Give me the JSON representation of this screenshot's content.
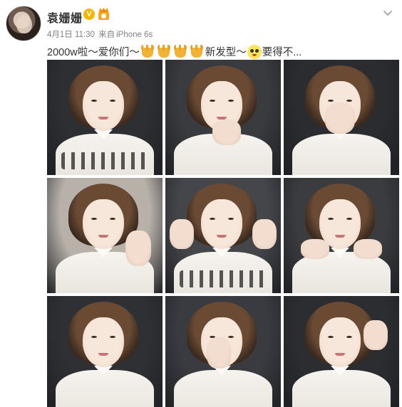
{
  "post": {
    "username": "袁姗姗",
    "verified_badge": "V",
    "timestamp": "4月1日 11:30",
    "source_prefix": "来自",
    "source": "iPhone 6s",
    "text_parts": [
      "2000w啦～爱你们～",
      "新发型～",
      "要得不..."
    ],
    "emoji_horns_count": 4,
    "icons": {
      "verified": "verified-v-icon",
      "member": "member-crown-icon",
      "menu": "chevron-down-icon"
    },
    "colors": {
      "badge": "#f7b500",
      "meta_text": "#808080",
      "text": "#333333"
    }
  },
  "photos": [
    {
      "label": "photo-1",
      "bg": "#2d2f33",
      "hair_offset": 0,
      "hand": "none",
      "pattern": true
    },
    {
      "label": "photo-2",
      "bg": "#3a3b3f",
      "hair_offset": 0,
      "hand": "chin",
      "pattern": false
    },
    {
      "label": "photo-3",
      "bg": "#2b2c30",
      "hair_offset": 0,
      "hand": "v-sign-face",
      "pattern": false
    },
    {
      "label": "photo-4",
      "bg": "#b7b1aa",
      "hair_offset": 0,
      "hand": "right",
      "pattern": false
    },
    {
      "label": "photo-5",
      "bg": "#45464a",
      "hair_offset": 0,
      "hand": "double-v",
      "pattern": true
    },
    {
      "label": "photo-6",
      "bg": "#3b3c40",
      "hair_offset": 0,
      "hand": "chin-double",
      "pattern": false
    },
    {
      "label": "photo-7",
      "bg": "#2f3034",
      "hair_offset": 0,
      "hand": "none",
      "pattern": false
    },
    {
      "label": "photo-8",
      "bg": "#3a3b40",
      "hair_offset": 0,
      "hand": "nose",
      "pattern": false
    },
    {
      "label": "photo-9",
      "bg": "#2c2d31",
      "hair_offset": 0,
      "hand": "head",
      "pattern": false
    }
  ]
}
